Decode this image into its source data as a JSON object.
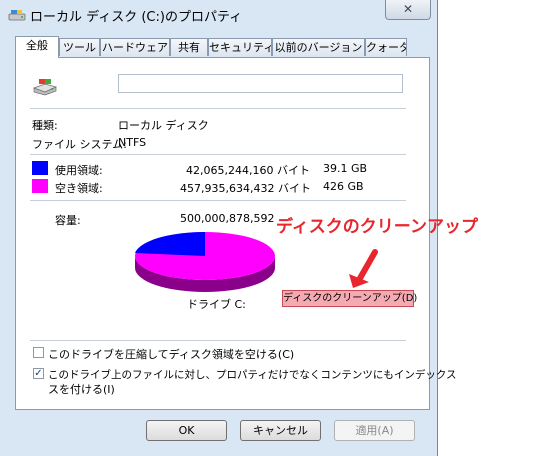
{
  "window": {
    "title": "ローカル ディスク (C:)のプロパティ",
    "close_symbol": "✕"
  },
  "tabs": [
    {
      "label": "全般"
    },
    {
      "label": "ツール"
    },
    {
      "label": "ハードウェア"
    },
    {
      "label": "共有"
    },
    {
      "label": "セキュリティ"
    },
    {
      "label": "以前のバージョン"
    },
    {
      "label": "クォータ"
    }
  ],
  "general": {
    "name_value": "",
    "type_label": "種類:",
    "type_value": "ローカル ディスク",
    "fs_label": "ファイル システム:",
    "fs_value": "NTFS",
    "used": {
      "label": "使用領域:",
      "bytes": "42,065,244,160 バイト",
      "size": "39.1 GB",
      "color": "#0000ff"
    },
    "free": {
      "label": "空き領域:",
      "bytes": "457,935,634,432 バイト",
      "size": "426 GB",
      "color": "#ff00ff"
    },
    "capacity_label": "容量:",
    "capacity_bytes": "500,000,878,592",
    "drive_label": "ドライブ C:",
    "cleanup_button": "ディスクのクリーンアップ(D)",
    "compress_label": "このドライブを圧縮してディスク領域を空ける(C)",
    "compress_checked": false,
    "index_label_line1": "このドライブ上のファイルに対し、プロパティだけでなくコンテンツにもインデックス",
    "index_label_line2": "スを付ける(I)",
    "index_checked": true
  },
  "annotation": {
    "callout_text": "ディスクのクリーンアップ",
    "color": "#e8262d"
  },
  "buttons": {
    "ok": "OK",
    "cancel": "キャンセル",
    "apply": "適用(A)"
  }
}
